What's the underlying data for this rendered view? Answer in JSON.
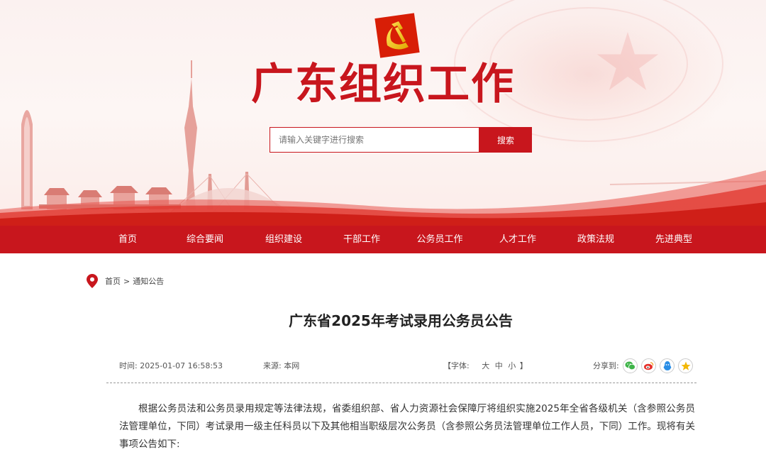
{
  "site": {
    "title": "广东组织工作"
  },
  "search": {
    "placeholder": "请输入关键字进行搜索",
    "button_label": "搜索"
  },
  "nav": {
    "items": [
      "首页",
      "综合要闻",
      "组织建设",
      "干部工作",
      "公务员工作",
      "人才工作",
      "政策法规",
      "先进典型"
    ]
  },
  "breadcrumb": {
    "home": "首页",
    "separator": ">",
    "current": "通知公告"
  },
  "article": {
    "title": "广东省2025年考试录用公务员公告",
    "time": "时间: 2025-01-07 16:58:53",
    "source": "来源: 本网",
    "font_prefix": "【字体:",
    "font_large": "大",
    "font_medium": "中",
    "font_small": "小",
    "font_suffix": "】",
    "share_label": "分享到:",
    "body": "根据公务员法和公务员录用规定等法律法规，省委组织部、省人力资源社会保障厅将组织实施2025年全省各级机关（含参照公务员法管理单位，下同）考试录用一级主任科员以下及其他相当职级层次公务员（含参照公务员法管理单位工作人员，下同）工作。现将有关事项公告如下:"
  },
  "share_icons": [
    "wechat-icon",
    "weibo-icon",
    "qq-icon",
    "qzone-icon"
  ],
  "colors": {
    "brand_red": "#c8161d",
    "nav_text": "#ffffff"
  }
}
